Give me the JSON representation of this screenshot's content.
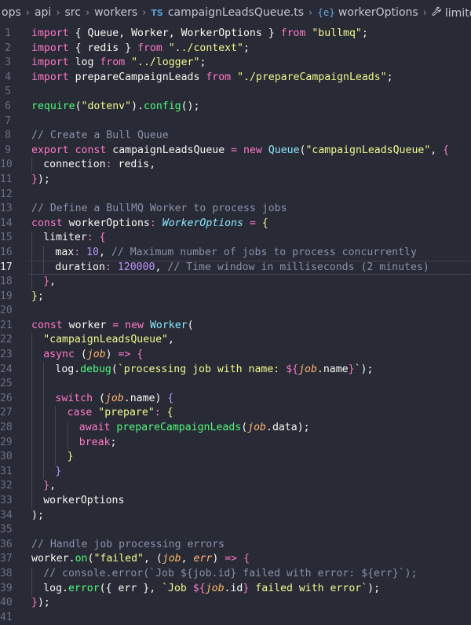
{
  "breadcrumb": [
    {
      "label": "ops",
      "kind": "folder"
    },
    {
      "label": "api",
      "kind": "folder"
    },
    {
      "label": "src",
      "kind": "folder"
    },
    {
      "label": "workers",
      "kind": "folder"
    },
    {
      "label": "campaignLeadsQueue.ts",
      "kind": "file",
      "badge": "TS"
    },
    {
      "label": "workerOptions",
      "kind": "symbol",
      "icon": "{e}"
    },
    {
      "label": "limiter",
      "kind": "property",
      "icon": "wrench-icon"
    }
  ],
  "editor": {
    "language": "typescript",
    "active_line": 17,
    "lines": [
      {
        "n": "1",
        "indent": 0,
        "tokens": [
          [
            "kw",
            "import"
          ],
          [
            "punc",
            " { "
          ],
          [
            "var",
            "Queue"
          ],
          [
            "punc",
            ", "
          ],
          [
            "var",
            "Worker"
          ],
          [
            "punc",
            ", "
          ],
          [
            "var",
            "WorkerOptions"
          ],
          [
            "punc",
            " } "
          ],
          [
            "kw",
            "from"
          ],
          [
            "punc",
            " "
          ],
          [
            "str",
            "\"bullmq\""
          ],
          [
            "punc",
            ";"
          ]
        ]
      },
      {
        "n": "2",
        "indent": 0,
        "tokens": [
          [
            "kw",
            "import"
          ],
          [
            "punc",
            " { "
          ],
          [
            "var",
            "redis"
          ],
          [
            "punc",
            " } "
          ],
          [
            "kw",
            "from"
          ],
          [
            "punc",
            " "
          ],
          [
            "str",
            "\"../context\""
          ],
          [
            "punc",
            ";"
          ]
        ]
      },
      {
        "n": "3",
        "indent": 0,
        "tokens": [
          [
            "kw",
            "import"
          ],
          [
            "punc",
            " "
          ],
          [
            "var",
            "log"
          ],
          [
            "punc",
            " "
          ],
          [
            "kw",
            "from"
          ],
          [
            "punc",
            " "
          ],
          [
            "str",
            "\"../logger\""
          ],
          [
            "punc",
            ";"
          ]
        ]
      },
      {
        "n": "4",
        "indent": 0,
        "tokens": [
          [
            "kw",
            "import"
          ],
          [
            "punc",
            " "
          ],
          [
            "var",
            "prepareCampaignLeads"
          ],
          [
            "punc",
            " "
          ],
          [
            "kw",
            "from"
          ],
          [
            "punc",
            " "
          ],
          [
            "str",
            "\"./prepareCampaignLeads\""
          ],
          [
            "punc",
            ";"
          ]
        ]
      },
      {
        "n": "5",
        "indent": 0,
        "tokens": []
      },
      {
        "n": "6",
        "indent": 0,
        "tokens": [
          [
            "fn",
            "require"
          ],
          [
            "punc",
            "("
          ],
          [
            "str",
            "\"dotenv\""
          ],
          [
            "punc",
            ")."
          ],
          [
            "fn",
            "config"
          ],
          [
            "punc",
            "();"
          ]
        ]
      },
      {
        "n": "7",
        "indent": 0,
        "tokens": []
      },
      {
        "n": "8",
        "indent": 0,
        "tokens": [
          [
            "com",
            "// Create a Bull Queue"
          ]
        ]
      },
      {
        "n": "9",
        "indent": 0,
        "tokens": [
          [
            "kw",
            "export"
          ],
          [
            "punc",
            " "
          ],
          [
            "kw",
            "const"
          ],
          [
            "punc",
            " "
          ],
          [
            "var",
            "campaignLeadsQueue"
          ],
          [
            "punc",
            " "
          ],
          [
            "kw",
            "="
          ],
          [
            "punc",
            " "
          ],
          [
            "kw",
            "new"
          ],
          [
            "punc",
            " "
          ],
          [
            "cls",
            "Queue"
          ],
          [
            "punc",
            "("
          ],
          [
            "str",
            "\"campaignLeadsQueue\""
          ],
          [
            "punc",
            ", "
          ],
          [
            "brk",
            "{"
          ]
        ]
      },
      {
        "n": "10",
        "indent": 1,
        "tokens": [
          [
            "prop",
            "connection"
          ],
          [
            "kw",
            ":"
          ],
          [
            "punc",
            " "
          ],
          [
            "var",
            "redis"
          ],
          [
            "punc",
            ","
          ]
        ]
      },
      {
        "n": "11",
        "indent": 0,
        "tokens": [
          [
            "brk",
            "}"
          ],
          [
            "punc",
            ");"
          ]
        ]
      },
      {
        "n": "12",
        "indent": 0,
        "tokens": []
      },
      {
        "n": "13",
        "indent": 0,
        "tokens": [
          [
            "com",
            "// Define a BullMQ Worker to process jobs"
          ]
        ]
      },
      {
        "n": "14",
        "indent": 0,
        "tokens": [
          [
            "kw",
            "const"
          ],
          [
            "punc",
            " "
          ],
          [
            "var",
            "workerOptions"
          ],
          [
            "kw",
            ":"
          ],
          [
            "punc",
            " "
          ],
          [
            "type",
            "WorkerOptions"
          ],
          [
            "punc",
            " "
          ],
          [
            "kw",
            "="
          ],
          [
            "punc",
            " "
          ],
          [
            "brk3",
            "{"
          ]
        ]
      },
      {
        "n": "15",
        "indent": 1,
        "tokens": [
          [
            "prop",
            "limiter"
          ],
          [
            "kw",
            ":"
          ],
          [
            "punc",
            " "
          ],
          [
            "brk",
            "{"
          ]
        ]
      },
      {
        "n": "16",
        "indent": 2,
        "tokens": [
          [
            "prop",
            "max"
          ],
          [
            "kw",
            ":"
          ],
          [
            "punc",
            " "
          ],
          [
            "num",
            "10"
          ],
          [
            "punc",
            ", "
          ],
          [
            "com",
            "// Maximum number of jobs to process concurrently"
          ]
        ]
      },
      {
        "n": "17",
        "indent": 2,
        "tokens": [
          [
            "prop",
            "duration"
          ],
          [
            "kw",
            ":"
          ],
          [
            "punc",
            " "
          ],
          [
            "num",
            "120000"
          ],
          [
            "punc",
            ", "
          ],
          [
            "com",
            "// Time window in milliseconds (2 minutes)"
          ]
        ]
      },
      {
        "n": "18",
        "indent": 1,
        "tokens": [
          [
            "brk",
            "}"
          ],
          [
            "punc",
            ","
          ]
        ]
      },
      {
        "n": "19",
        "indent": 0,
        "tokens": [
          [
            "brk3",
            "}"
          ],
          [
            "punc",
            ";"
          ]
        ]
      },
      {
        "n": "20",
        "indent": 0,
        "tokens": []
      },
      {
        "n": "21",
        "indent": 0,
        "tokens": [
          [
            "kw",
            "const"
          ],
          [
            "punc",
            " "
          ],
          [
            "var",
            "worker"
          ],
          [
            "punc",
            " "
          ],
          [
            "kw",
            "="
          ],
          [
            "punc",
            " "
          ],
          [
            "kw",
            "new"
          ],
          [
            "punc",
            " "
          ],
          [
            "cls",
            "Worker"
          ],
          [
            "punc",
            "("
          ]
        ]
      },
      {
        "n": "22",
        "indent": 1,
        "tokens": [
          [
            "str",
            "\"campaignLeadsQueue\""
          ],
          [
            "punc",
            ","
          ]
        ]
      },
      {
        "n": "23",
        "indent": 1,
        "tokens": [
          [
            "kw",
            "async"
          ],
          [
            "punc",
            " ("
          ],
          [
            "par",
            "job"
          ],
          [
            "punc",
            ") "
          ],
          [
            "kw",
            "=>"
          ],
          [
            "punc",
            " "
          ],
          [
            "brk",
            "{"
          ]
        ]
      },
      {
        "n": "24",
        "indent": 2,
        "tokens": [
          [
            "var",
            "log"
          ],
          [
            "punc",
            "."
          ],
          [
            "fn",
            "debug"
          ],
          [
            "punc",
            "("
          ],
          [
            "str",
            "`processing job with name: "
          ],
          [
            "tpl",
            "${"
          ],
          [
            "par",
            "job"
          ],
          [
            "punc",
            "."
          ],
          [
            "var",
            "name"
          ],
          [
            "tpl",
            "}"
          ],
          [
            "str",
            "`"
          ],
          [
            "punc",
            ");"
          ]
        ]
      },
      {
        "n": "25",
        "indent": 2,
        "tokens": []
      },
      {
        "n": "26",
        "indent": 2,
        "tokens": [
          [
            "kw",
            "switch"
          ],
          [
            "punc",
            " ("
          ],
          [
            "par",
            "job"
          ],
          [
            "punc",
            "."
          ],
          [
            "var",
            "name"
          ],
          [
            "punc",
            ") "
          ],
          [
            "brk2",
            "{"
          ]
        ]
      },
      {
        "n": "27",
        "indent": 3,
        "tokens": [
          [
            "kw",
            "case"
          ],
          [
            "punc",
            " "
          ],
          [
            "str",
            "\"prepare\""
          ],
          [
            "kw",
            ":"
          ],
          [
            "punc",
            " "
          ],
          [
            "brk3",
            "{"
          ]
        ]
      },
      {
        "n": "28",
        "indent": 4,
        "tokens": [
          [
            "kw",
            "await"
          ],
          [
            "punc",
            " "
          ],
          [
            "fn",
            "prepareCampaignLeads"
          ],
          [
            "punc",
            "("
          ],
          [
            "par",
            "job"
          ],
          [
            "punc",
            "."
          ],
          [
            "var",
            "data"
          ],
          [
            "punc",
            ");"
          ]
        ]
      },
      {
        "n": "29",
        "indent": 4,
        "tokens": [
          [
            "kw",
            "break"
          ],
          [
            "punc",
            ";"
          ]
        ]
      },
      {
        "n": "30",
        "indent": 3,
        "tokens": [
          [
            "brk3",
            "}"
          ]
        ]
      },
      {
        "n": "31",
        "indent": 2,
        "tokens": [
          [
            "brk2",
            "}"
          ]
        ]
      },
      {
        "n": "32",
        "indent": 1,
        "tokens": [
          [
            "brk",
            "}"
          ],
          [
            "punc",
            ","
          ]
        ]
      },
      {
        "n": "33",
        "indent": 1,
        "tokens": [
          [
            "var",
            "workerOptions"
          ]
        ]
      },
      {
        "n": "34",
        "indent": 0,
        "tokens": [
          [
            "punc",
            ");"
          ]
        ]
      },
      {
        "n": "35",
        "indent": 0,
        "tokens": []
      },
      {
        "n": "36",
        "indent": 0,
        "tokens": [
          [
            "com",
            "// Handle job processing errors"
          ]
        ]
      },
      {
        "n": "37",
        "indent": 0,
        "tokens": [
          [
            "var",
            "worker"
          ],
          [
            "punc",
            "."
          ],
          [
            "fn",
            "on"
          ],
          [
            "punc",
            "("
          ],
          [
            "str",
            "\"failed\""
          ],
          [
            "punc",
            ", ("
          ],
          [
            "par",
            "job"
          ],
          [
            "punc",
            ", "
          ],
          [
            "par",
            "err"
          ],
          [
            "punc",
            ") "
          ],
          [
            "kw",
            "=>"
          ],
          [
            "punc",
            " "
          ],
          [
            "brk",
            "{"
          ]
        ]
      },
      {
        "n": "38",
        "indent": 1,
        "tokens": [
          [
            "com",
            "// console.error(`Job ${job.id} failed with error: ${err}`);"
          ]
        ]
      },
      {
        "n": "39",
        "indent": 1,
        "tokens": [
          [
            "var",
            "log"
          ],
          [
            "punc",
            "."
          ],
          [
            "fn",
            "error"
          ],
          [
            "punc",
            "({ "
          ],
          [
            "var",
            "err"
          ],
          [
            "punc",
            " }, "
          ],
          [
            "str",
            "`Job "
          ],
          [
            "tpl",
            "${"
          ],
          [
            "par",
            "job"
          ],
          [
            "punc",
            "."
          ],
          [
            "var",
            "id"
          ],
          [
            "tpl",
            "}"
          ],
          [
            "str",
            " failed with error`"
          ],
          [
            "punc",
            ");"
          ]
        ]
      },
      {
        "n": "40",
        "indent": 0,
        "tokens": [
          [
            "brk",
            "}"
          ],
          [
            "punc",
            ");"
          ]
        ]
      },
      {
        "n": "41",
        "indent": 0,
        "tokens": []
      }
    ]
  }
}
